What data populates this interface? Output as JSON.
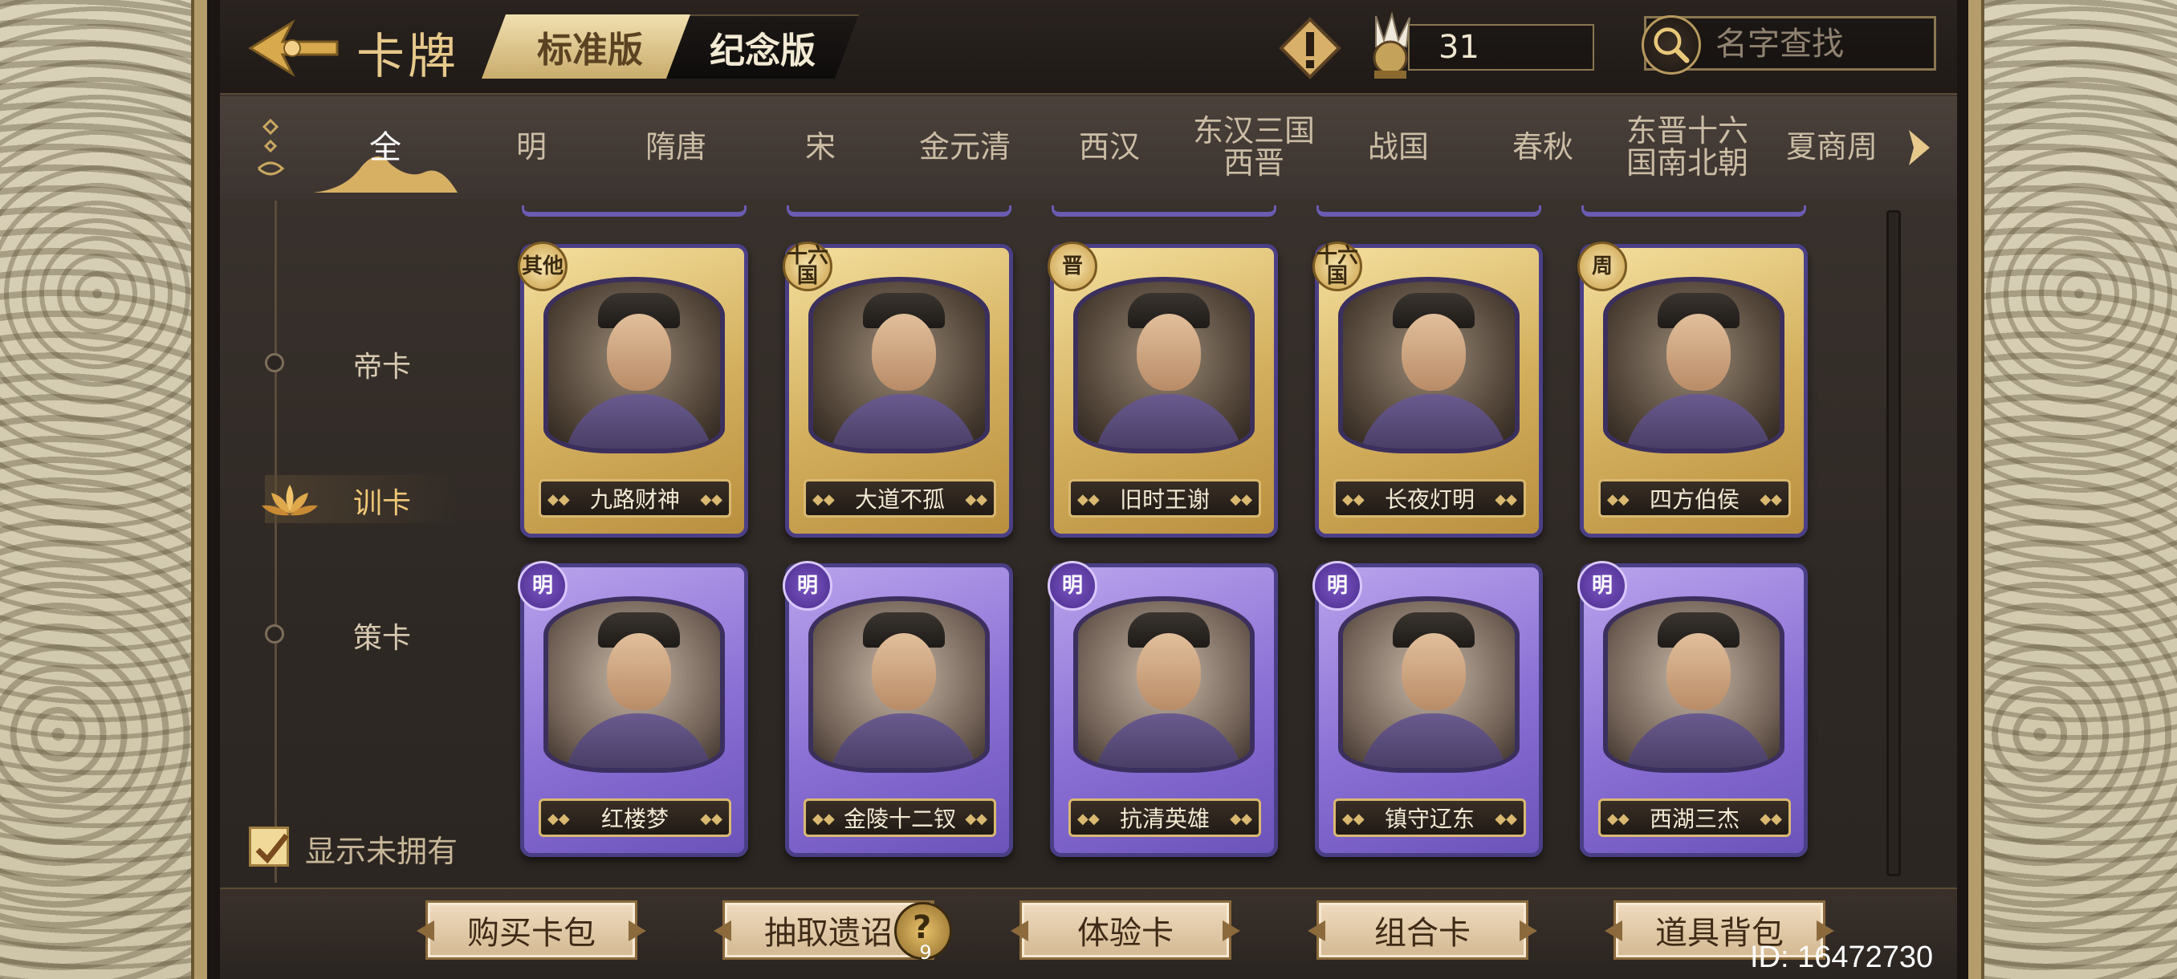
{
  "header": {
    "title": "卡牌",
    "version_tabs": [
      "标准版",
      "纪念版"
    ],
    "currency_value": "31",
    "search_placeholder": "名字查找"
  },
  "dynasty_tabs": [
    "全",
    "明",
    "隋唐",
    "宋",
    "金元清",
    "西汉",
    "东汉三国\n西晋",
    "战国",
    "春秋",
    "东晋十六\n国南北朝",
    "夏商周"
  ],
  "categories": [
    "帝卡",
    "训卡",
    "策卡"
  ],
  "active_category": "训卡",
  "show_unowned_label": "显示未拥有",
  "cards_row1": [
    {
      "badge": "其他",
      "name": "九路财神"
    },
    {
      "badge": "十六国",
      "name": "大道不孤"
    },
    {
      "badge": "晋",
      "name": "旧时王谢"
    },
    {
      "badge": "十六国",
      "name": "长夜灯明"
    },
    {
      "badge": "周",
      "name": "四方伯侯"
    }
  ],
  "cards_row2": [
    {
      "badge": "明",
      "name": "红楼梦"
    },
    {
      "badge": "明",
      "name": "金陵十二钗"
    },
    {
      "badge": "明",
      "name": "抗清英雄"
    },
    {
      "badge": "明",
      "name": "镇守辽东"
    },
    {
      "badge": "明",
      "name": "西湖三杰"
    }
  ],
  "bottom_buttons": [
    "购买卡包",
    "抽取遗诏",
    "体验卡",
    "组合卡",
    "道具背包"
  ],
  "edict_count": "9",
  "user_id": "ID: 16472730",
  "colors": {
    "accent_gold": "#e6c98b",
    "card_gold": "#d2ae5c",
    "card_purple": "#8a6fd4"
  }
}
